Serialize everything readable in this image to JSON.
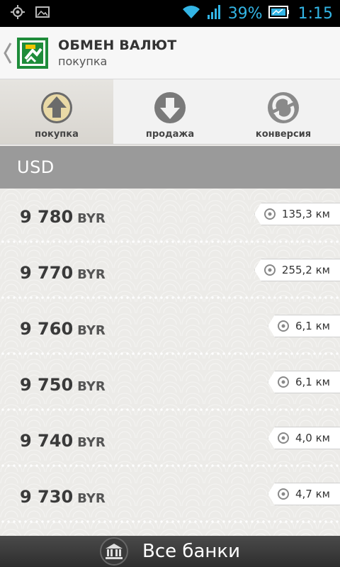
{
  "status_bar": {
    "battery_percent": "39%",
    "time": "1:15"
  },
  "action_bar": {
    "title": "ОБМЕН ВАЛЮТ",
    "subtitle": "покупка"
  },
  "tabs": [
    {
      "label": "покупка",
      "icon": "arrow-up-icon",
      "active": true
    },
    {
      "label": "продажа",
      "icon": "arrow-down-icon",
      "active": false
    },
    {
      "label": "конверсия",
      "icon": "conversion-icon",
      "active": false
    }
  ],
  "currency": "USD",
  "rates": [
    {
      "value": "9 780",
      "currency": "BYR",
      "distance": "135,3 км"
    },
    {
      "value": "9 770",
      "currency": "BYR",
      "distance": "255,2 км"
    },
    {
      "value": "9 760",
      "currency": "BYR",
      "distance": "6,1 км"
    },
    {
      "value": "9 750",
      "currency": "BYR",
      "distance": "6,1 км"
    },
    {
      "value": "9 740",
      "currency": "BYR",
      "distance": "4,0 км"
    },
    {
      "value": "9 730",
      "currency": "BYR",
      "distance": "4,7 км"
    }
  ],
  "bottom_bar": {
    "label": "Все банки",
    "icon": "bank-icon"
  },
  "colors": {
    "accent": "#33b5e5",
    "header_gray": "#9a9a9a",
    "logo_green": "#1e8c3a"
  }
}
